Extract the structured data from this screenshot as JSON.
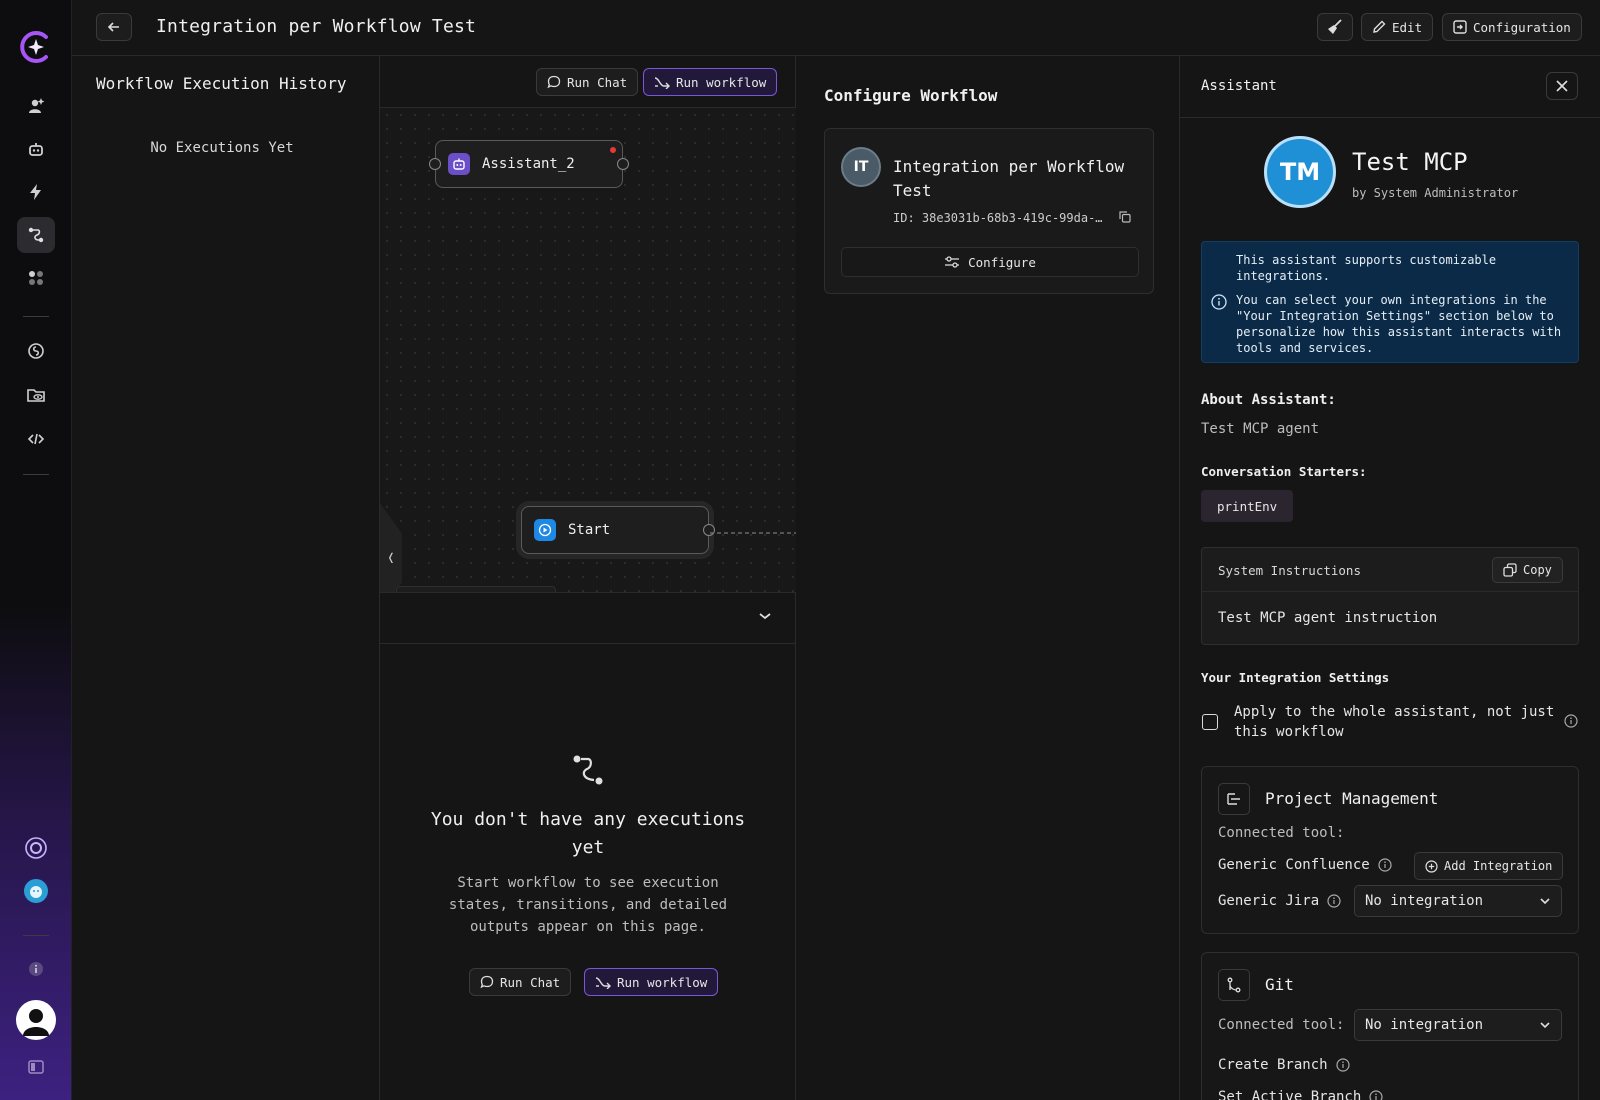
{
  "header": {
    "title": "Integration per Workflow Test",
    "edit_label": "Edit",
    "configuration_label": "Configuration"
  },
  "history": {
    "title": "Workflow Execution History",
    "empty": "No Executions Yet"
  },
  "canvas": {
    "run_chat_label": "Run Chat",
    "run_workflow_label": "Run workflow",
    "nodes": [
      {
        "label": "Assistant_2",
        "icon": "robot-icon"
      },
      {
        "label": "Start",
        "icon": "play-circle-icon"
      }
    ],
    "zoom_controls": [
      "zoom-in-icon",
      "zoom-out-icon",
      "fit-view-icon",
      "download-icon",
      "fullscreen-icon"
    ]
  },
  "empty_state": {
    "title": "You don't have any executions yet",
    "description": "Start workflow to see execution states, transitions, and detailed outputs appear on this page.",
    "run_chat_label": "Run Chat",
    "run_workflow_label": "Run workflow"
  },
  "configure": {
    "title": "Configure Workflow",
    "avatar_initials": "IT",
    "workflow_name": "Integration per Workflow Test",
    "workflow_id": "ID: 38e3031b-68b3-419c-99da-…",
    "configure_label": "Configure"
  },
  "assistant": {
    "panel_title": "Assistant",
    "avatar_initials": "TM",
    "name": "Test MCP",
    "author": "by System Administrator",
    "info_line1": "This assistant supports customizable integrations.",
    "info_line2": "You can select your own integrations in the \"Your Integration Settings\" section below to personalize how this assistant interacts with tools and services.",
    "about_label": "About Assistant:",
    "about_text": "Test MCP agent",
    "starters_label": "Conversation Starters:",
    "starters": [
      "printEnv"
    ],
    "system_instructions_label": "System Instructions",
    "copy_label": "Copy",
    "system_instructions": "Test MCP agent instruction",
    "integration_settings_label": "Your Integration Settings",
    "apply_label": "Apply to the whole assistant, not just this workflow",
    "apply_checked": false,
    "project_management": {
      "title": "Project Management",
      "connected_label": "Connected tool:",
      "confluence_label": "Generic Confluence",
      "add_integration_label": "Add Integration",
      "jira_label": "Generic Jira",
      "jira_value": "No integration"
    },
    "git": {
      "title": "Git",
      "connected_label": "Connected tool:",
      "connected_value": "No integration",
      "create_branch_label": "Create Branch",
      "set_active_branch_label": "Set Active Branch"
    }
  },
  "colors": {
    "accent": "#8b5cf6",
    "info_bg": "#0a2a47",
    "avatar_blue": "#1f8fd6"
  }
}
